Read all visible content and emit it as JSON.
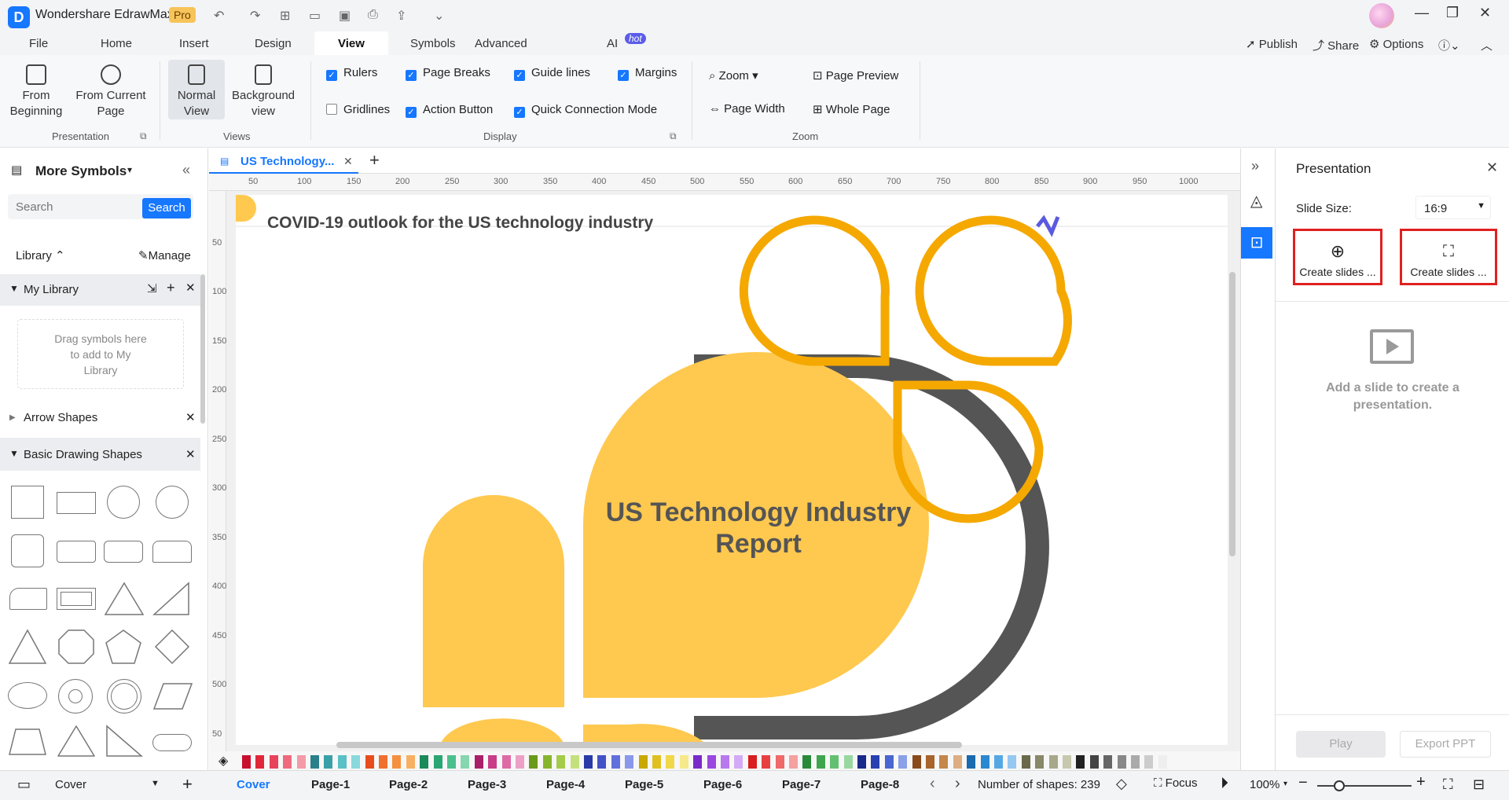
{
  "app": {
    "title": "Wondershare EdrawMax",
    "badge": "Pro"
  },
  "colors": {
    "accent": "#1677ff",
    "yellow": "#ffc94f",
    "orange": "#f5a800",
    "dark": "#555555",
    "highlight": "#e02020"
  },
  "menu": {
    "items": [
      "File",
      "Home",
      "Insert",
      "Design",
      "View",
      "Symbols",
      "Advanced",
      "AI"
    ],
    "active": "View",
    "ai_badge": "hot",
    "right": {
      "publish": "Publish",
      "share": "Share",
      "options": "Options"
    }
  },
  "ribbon": {
    "presentation": {
      "from_beginning": "From Beginning",
      "from_current_page": "From Current Page",
      "group_label": "Presentation"
    },
    "views": {
      "normal_view": "Normal View",
      "background_view": "Background view",
      "group_label": "Views"
    },
    "display": {
      "group_label": "Display",
      "rulers": "Rulers",
      "page_breaks": "Page Breaks",
      "guide_lines": "Guide lines",
      "margins": "Margins",
      "gridlines": "Gridlines",
      "action_button": "Action Button",
      "quick_connection_mode": "Quick Connection Mode"
    },
    "zoom": {
      "zoom": "Zoom",
      "page_preview": "Page Preview",
      "page_width": "Page Width",
      "whole_page": "Whole Page",
      "group_label": "Zoom"
    }
  },
  "left_panel": {
    "title": "More Symbols",
    "search_placeholder": "Search",
    "search_button": "Search",
    "library": "Library",
    "manage": "Manage",
    "my_library": "My Library",
    "drag_hint": "Drag symbols here to add to My Library",
    "arrow_shapes": "Arrow Shapes",
    "basic_drawing_shapes": "Basic Drawing Shapes"
  },
  "document": {
    "tab_title": "US Technology...",
    "ruler_h": [
      "50",
      "100",
      "150",
      "200",
      "250",
      "300",
      "350",
      "400",
      "450",
      "500",
      "550",
      "600",
      "650",
      "700",
      "750",
      "800",
      "850",
      "900",
      "950",
      "1000"
    ],
    "ruler_v": [
      "50",
      "100",
      "150",
      "200",
      "250",
      "300",
      "350",
      "400",
      "450",
      "500",
      "50"
    ],
    "slide_heading": "COVID-19 outlook for the US technology industry",
    "main_title_line1": "US Technology Industry",
    "main_title_line2": "Report"
  },
  "right_panel": {
    "title": "Presentation",
    "slide_size_label": "Slide Size:",
    "slide_size_value": "16:9",
    "create_slides_1": "Create slides ...",
    "create_slides_2": "Create slides ...",
    "empty_hint": "Add a slide to create a presentation.",
    "play": "Play",
    "export_ppt": "Export PPT"
  },
  "status": {
    "current_page": "Cover",
    "pages": [
      "Cover",
      "Page-1",
      "Page-2",
      "Page-3",
      "Page-4",
      "Page-5",
      "Page-6",
      "Page-7",
      "Page-8"
    ],
    "shape_count": "Number of shapes: 239",
    "focus": "Focus",
    "zoom": "100%"
  },
  "palette": [
    "#c8102e",
    "#e0283a",
    "#e8435a",
    "#ef6a7d",
    "#f49aa8",
    "#2a7f8a",
    "#3aa0a8",
    "#58c0c6",
    "#8ad8dc",
    "#e84e1b",
    "#f07030",
    "#f5903f",
    "#f7b062",
    "#1a8a5a",
    "#2aa673",
    "#4cbf8e",
    "#86d6b0",
    "#a8206a",
    "#c83c88",
    "#de6aa6",
    "#eda0c6",
    "#6a9a1a",
    "#86b52c",
    "#a4cc4a",
    "#c4e07c",
    "#2a3aa8",
    "#4452c8",
    "#6070dc",
    "#8a98ec",
    "#c9a800",
    "#e0c020",
    "#f0d848",
    "#f6e98a",
    "#7a2ac8",
    "#9a48e0",
    "#b878ee",
    "#d4aaf6",
    "#d81e1e",
    "#e84040",
    "#f06a6a",
    "#f6a0a0",
    "#2a8a3a",
    "#3ea64e",
    "#62c070",
    "#98d8a0",
    "#1a2a8a",
    "#2840b0",
    "#4a66d0",
    "#8aa0e8",
    "#8a4a1a",
    "#a8642a",
    "#c4864a",
    "#dcae82",
    "#1a6ab0",
    "#2a88d0",
    "#56a8e4",
    "#94c8f0",
    "#6a6a4a",
    "#88886a",
    "#a8a88a",
    "#c8c8ae",
    "#222222",
    "#444444",
    "#666666",
    "#888888",
    "#aaaaaa",
    "#cccccc",
    "#eeeeee"
  ]
}
